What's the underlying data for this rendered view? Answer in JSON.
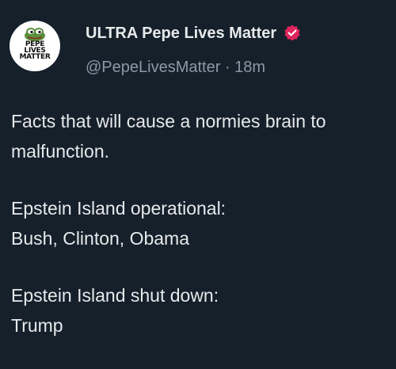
{
  "author": {
    "display_name": "ULTRA Pepe Lives Matter",
    "handle": "@PepeLivesMatter",
    "separator": " · ",
    "time_ago": "18m",
    "verified_badge_color": "#e0245e",
    "avatar_text": [
      "PEPE",
      "LIVES",
      "MATTER"
    ],
    "avatar_icon": "pepe-frog-icon"
  },
  "tweet": {
    "paragraphs": [
      [
        "Facts that will cause a normies brain to",
        "malfunction."
      ],
      [
        "Epstein Island operational:",
        "Bush, Clinton, Obama"
      ],
      [
        "Epstein Island shut down:",
        "Trump"
      ]
    ]
  },
  "colors": {
    "background": "#15202b",
    "text": "#e7e9ea",
    "secondary_text": "#8b98a5"
  }
}
